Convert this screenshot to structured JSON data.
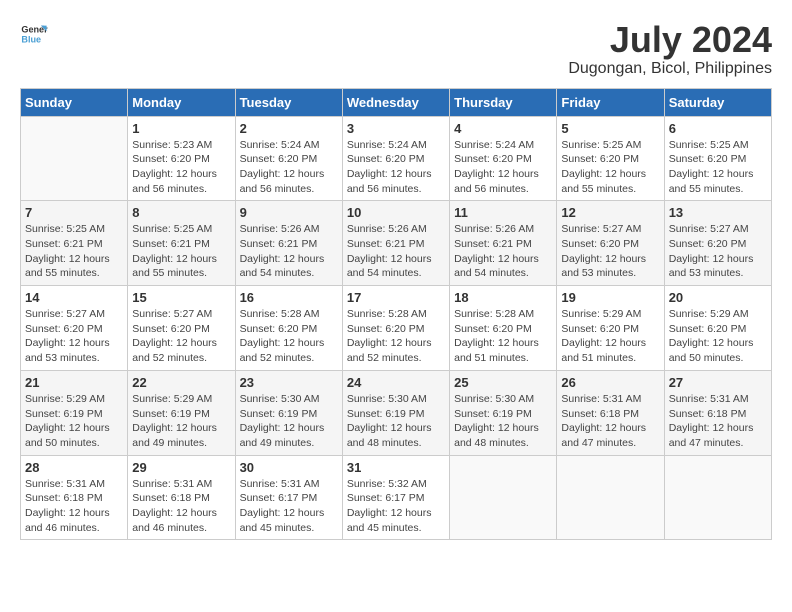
{
  "header": {
    "logo_line1": "General",
    "logo_line2": "Blue",
    "month_year": "July 2024",
    "location": "Dugongan, Bicol, Philippines"
  },
  "days_of_week": [
    "Sunday",
    "Monday",
    "Tuesday",
    "Wednesday",
    "Thursday",
    "Friday",
    "Saturday"
  ],
  "weeks": [
    [
      {
        "day": "",
        "info": ""
      },
      {
        "day": "1",
        "info": "Sunrise: 5:23 AM\nSunset: 6:20 PM\nDaylight: 12 hours\nand 56 minutes."
      },
      {
        "day": "2",
        "info": "Sunrise: 5:24 AM\nSunset: 6:20 PM\nDaylight: 12 hours\nand 56 minutes."
      },
      {
        "day": "3",
        "info": "Sunrise: 5:24 AM\nSunset: 6:20 PM\nDaylight: 12 hours\nand 56 minutes."
      },
      {
        "day": "4",
        "info": "Sunrise: 5:24 AM\nSunset: 6:20 PM\nDaylight: 12 hours\nand 56 minutes."
      },
      {
        "day": "5",
        "info": "Sunrise: 5:25 AM\nSunset: 6:20 PM\nDaylight: 12 hours\nand 55 minutes."
      },
      {
        "day": "6",
        "info": "Sunrise: 5:25 AM\nSunset: 6:20 PM\nDaylight: 12 hours\nand 55 minutes."
      }
    ],
    [
      {
        "day": "7",
        "info": "Sunrise: 5:25 AM\nSunset: 6:21 PM\nDaylight: 12 hours\nand 55 minutes."
      },
      {
        "day": "8",
        "info": "Sunrise: 5:25 AM\nSunset: 6:21 PM\nDaylight: 12 hours\nand 55 minutes."
      },
      {
        "day": "9",
        "info": "Sunrise: 5:26 AM\nSunset: 6:21 PM\nDaylight: 12 hours\nand 54 minutes."
      },
      {
        "day": "10",
        "info": "Sunrise: 5:26 AM\nSunset: 6:21 PM\nDaylight: 12 hours\nand 54 minutes."
      },
      {
        "day": "11",
        "info": "Sunrise: 5:26 AM\nSunset: 6:21 PM\nDaylight: 12 hours\nand 54 minutes."
      },
      {
        "day": "12",
        "info": "Sunrise: 5:27 AM\nSunset: 6:20 PM\nDaylight: 12 hours\nand 53 minutes."
      },
      {
        "day": "13",
        "info": "Sunrise: 5:27 AM\nSunset: 6:20 PM\nDaylight: 12 hours\nand 53 minutes."
      }
    ],
    [
      {
        "day": "14",
        "info": "Sunrise: 5:27 AM\nSunset: 6:20 PM\nDaylight: 12 hours\nand 53 minutes."
      },
      {
        "day": "15",
        "info": "Sunrise: 5:27 AM\nSunset: 6:20 PM\nDaylight: 12 hours\nand 52 minutes."
      },
      {
        "day": "16",
        "info": "Sunrise: 5:28 AM\nSunset: 6:20 PM\nDaylight: 12 hours\nand 52 minutes."
      },
      {
        "day": "17",
        "info": "Sunrise: 5:28 AM\nSunset: 6:20 PM\nDaylight: 12 hours\nand 52 minutes."
      },
      {
        "day": "18",
        "info": "Sunrise: 5:28 AM\nSunset: 6:20 PM\nDaylight: 12 hours\nand 51 minutes."
      },
      {
        "day": "19",
        "info": "Sunrise: 5:29 AM\nSunset: 6:20 PM\nDaylight: 12 hours\nand 51 minutes."
      },
      {
        "day": "20",
        "info": "Sunrise: 5:29 AM\nSunset: 6:20 PM\nDaylight: 12 hours\nand 50 minutes."
      }
    ],
    [
      {
        "day": "21",
        "info": "Sunrise: 5:29 AM\nSunset: 6:19 PM\nDaylight: 12 hours\nand 50 minutes."
      },
      {
        "day": "22",
        "info": "Sunrise: 5:29 AM\nSunset: 6:19 PM\nDaylight: 12 hours\nand 49 minutes."
      },
      {
        "day": "23",
        "info": "Sunrise: 5:30 AM\nSunset: 6:19 PM\nDaylight: 12 hours\nand 49 minutes."
      },
      {
        "day": "24",
        "info": "Sunrise: 5:30 AM\nSunset: 6:19 PM\nDaylight: 12 hours\nand 48 minutes."
      },
      {
        "day": "25",
        "info": "Sunrise: 5:30 AM\nSunset: 6:19 PM\nDaylight: 12 hours\nand 48 minutes."
      },
      {
        "day": "26",
        "info": "Sunrise: 5:31 AM\nSunset: 6:18 PM\nDaylight: 12 hours\nand 47 minutes."
      },
      {
        "day": "27",
        "info": "Sunrise: 5:31 AM\nSunset: 6:18 PM\nDaylight: 12 hours\nand 47 minutes."
      }
    ],
    [
      {
        "day": "28",
        "info": "Sunrise: 5:31 AM\nSunset: 6:18 PM\nDaylight: 12 hours\nand 46 minutes."
      },
      {
        "day": "29",
        "info": "Sunrise: 5:31 AM\nSunset: 6:18 PM\nDaylight: 12 hours\nand 46 minutes."
      },
      {
        "day": "30",
        "info": "Sunrise: 5:31 AM\nSunset: 6:17 PM\nDaylight: 12 hours\nand 45 minutes."
      },
      {
        "day": "31",
        "info": "Sunrise: 5:32 AM\nSunset: 6:17 PM\nDaylight: 12 hours\nand 45 minutes."
      },
      {
        "day": "",
        "info": ""
      },
      {
        "day": "",
        "info": ""
      },
      {
        "day": "",
        "info": ""
      }
    ]
  ]
}
